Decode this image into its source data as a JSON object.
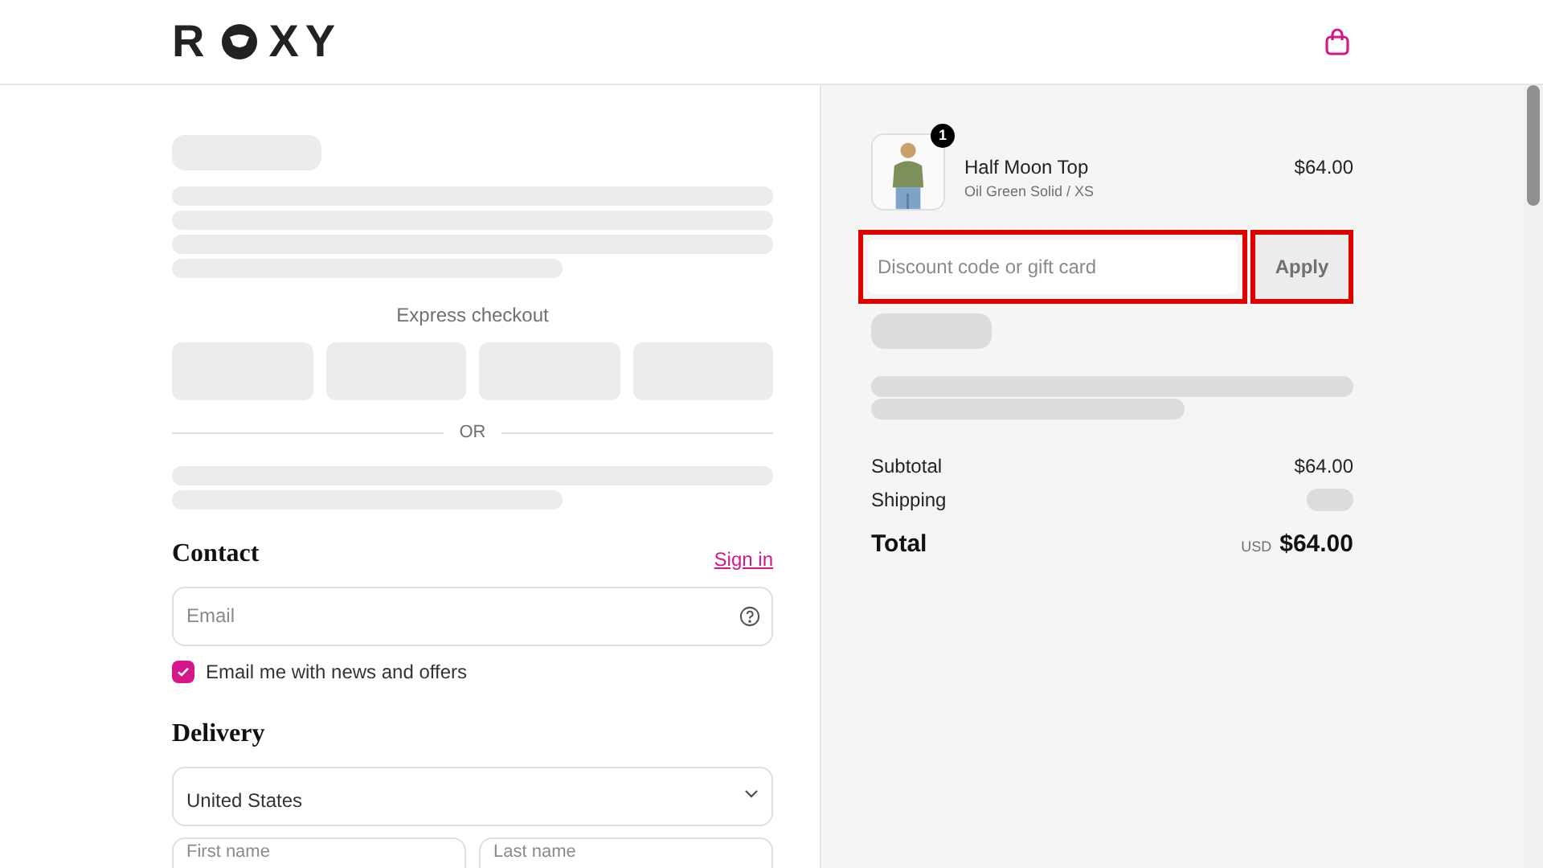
{
  "header": {
    "logo_letters": [
      "R",
      "X",
      "Y"
    ]
  },
  "express_checkout": {
    "label": "Express checkout",
    "divider": "OR"
  },
  "contact": {
    "title": "Contact",
    "sign_in": "Sign in",
    "email_placeholder": "Email",
    "newsletter": {
      "label": "Email me with news and offers",
      "checked": true
    }
  },
  "delivery": {
    "title": "Delivery",
    "country": "United States",
    "first_name_placeholder": "First name",
    "last_name_placeholder": "Last name"
  },
  "order": {
    "items": [
      {
        "name": "Half Moon Top",
        "variant": "Oil Green Solid / XS",
        "price": "$64.00",
        "quantity": "1"
      }
    ],
    "discount": {
      "placeholder": "Discount code or gift card",
      "button": "Apply"
    },
    "subtotal": {
      "label": "Subtotal",
      "value": "$64.00"
    },
    "shipping": {
      "label": "Shipping"
    },
    "total": {
      "label": "Total",
      "currency": "USD",
      "value": "$64.00"
    }
  }
}
